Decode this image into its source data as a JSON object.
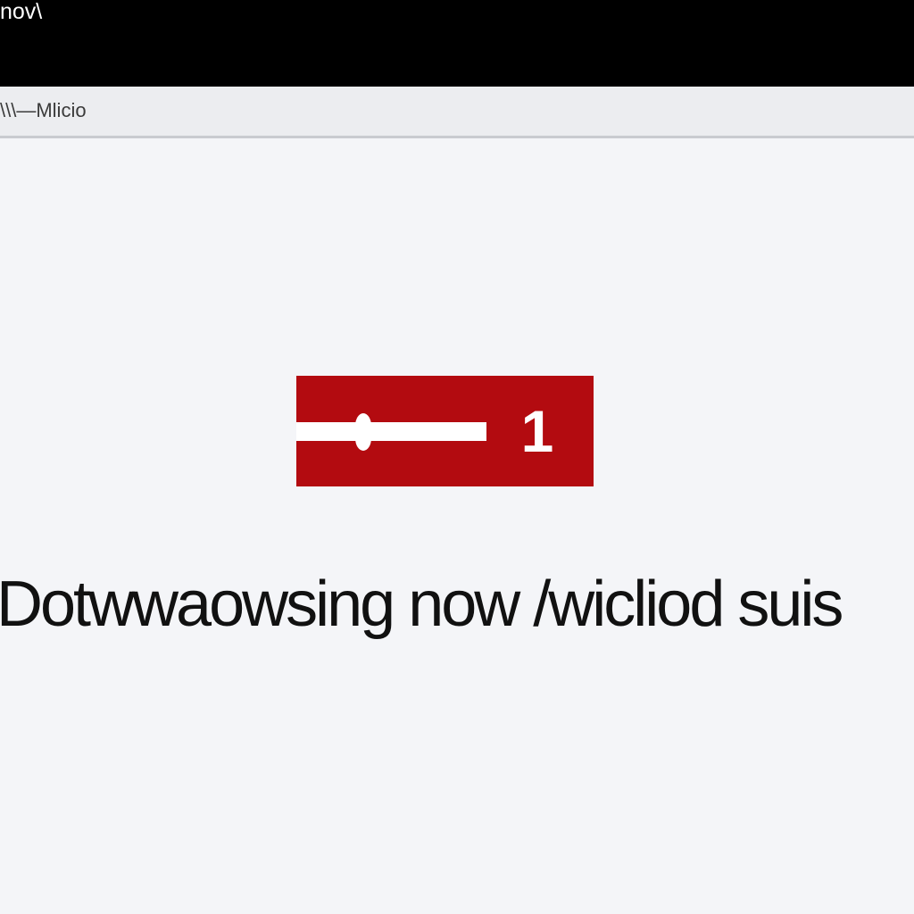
{
  "window": {
    "title": "nov\\"
  },
  "browser": {
    "address_text": "\\\\\\—Mlicio"
  },
  "download": {
    "progress_fraction": 0.35,
    "count_label": "1",
    "status_message": "Dotwwaowsing now /wicliod suis"
  },
  "colors": {
    "background": "#f4f5f8",
    "top_bar": "#000000",
    "address_bar": "#ecedf0",
    "banner": "#b30b10",
    "progress": "#ffffff",
    "text": "#111111"
  },
  "icons": {
    "progress_handle": "slider-handle"
  }
}
